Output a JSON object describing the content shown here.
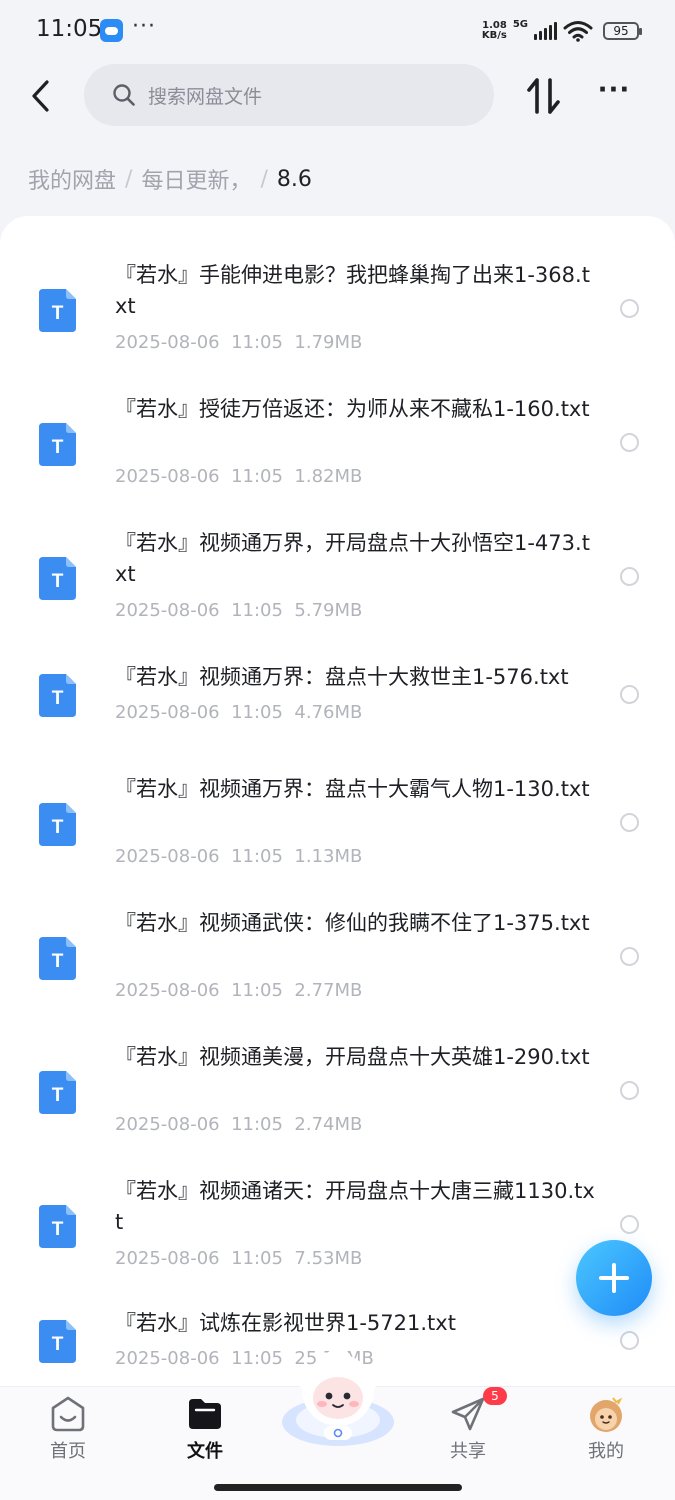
{
  "status_bar": {
    "time": "11:05",
    "speed_value": "1.08",
    "speed_unit": "KB/s",
    "network": "5G",
    "battery": "95",
    "more": "···"
  },
  "header": {
    "search_placeholder": "搜索网盘文件",
    "more_label": "···",
    "icons": {
      "back": "chevron-left-icon",
      "search": "search-icon",
      "sort": "sort-arrows-icon"
    }
  },
  "breadcrumb": [
    {
      "label": "我的网盘"
    },
    {
      "label": "每日更新，"
    },
    {
      "label": "8.6"
    }
  ],
  "breadcrumb_separator": "/",
  "colors": {
    "accent": "#2d8cf0",
    "file_icon": "#3b8df2",
    "badge": "#ff3b4a",
    "meta_text": "#b2b4bb",
    "background": "#f3f4f8"
  },
  "files": [
    {
      "name": "『若水』手能伸进电影？我把蜂巢掏了出来1-368.txt",
      "date": "2025-08-06",
      "time": "11:05",
      "size": "1.79MB",
      "icon_letter": "T"
    },
    {
      "name": "『若水』授徒万倍返还：为师从来不藏私1-160.txt",
      "date": "2025-08-06",
      "time": "11:05",
      "size": "1.82MB",
      "icon_letter": "T"
    },
    {
      "name": "『若水』视频通万界，开局盘点十大孙悟空1-473.txt",
      "date": "2025-08-06",
      "time": "11:05",
      "size": "5.79MB",
      "icon_letter": "T"
    },
    {
      "name": "『若水』视频通万界：盘点十大救世主1-576.txt",
      "date": "2025-08-06",
      "time": "11:05",
      "size": "4.76MB",
      "icon_letter": "T"
    },
    {
      "name": "『若水』视频通万界：盘点十大霸气人物1-130.txt",
      "date": "2025-08-06",
      "time": "11:05",
      "size": "1.13MB",
      "icon_letter": "T"
    },
    {
      "name": "『若水』视频通武侠：修仙的我瞒不住了1-375.txt",
      "date": "2025-08-06",
      "time": "11:05",
      "size": "2.77MB",
      "icon_letter": "T"
    },
    {
      "name": "『若水』视频通美漫，开局盘点十大英雄1-290.txt",
      "date": "2025-08-06",
      "time": "11:05",
      "size": "2.74MB",
      "icon_letter": "T"
    },
    {
      "name": "『若水』视频通诸天：开局盘点十大唐三藏1130.txt",
      "date": "2025-08-06",
      "time": "11:05",
      "size": "7.53MB",
      "icon_letter": "T"
    },
    {
      "name": "『若水』试炼在影视世界1-5721.txt",
      "date": "2025-08-06",
      "time": "11:05",
      "size": "25.77MB",
      "icon_letter": "T"
    }
  ],
  "fab": {
    "icon": "plus-icon"
  },
  "bottom_nav": [
    {
      "label": "首页",
      "icon": "home-icon"
    },
    {
      "label": "文件",
      "icon": "folder-icon",
      "active": true
    },
    {
      "label": "共享",
      "icon": "send-icon",
      "badge": "5"
    },
    {
      "label": "我的",
      "icon": "avatar-icon"
    }
  ],
  "mascot": {
    "icon": "mascot-avatar-icon"
  }
}
